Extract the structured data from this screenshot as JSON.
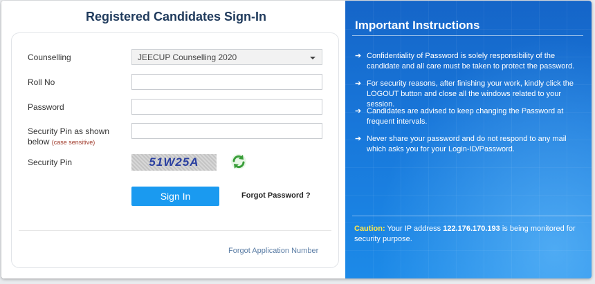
{
  "login": {
    "title": "Registered Candidates Sign-In",
    "counselling_label": "Counselling",
    "counselling_value": "JEECUP Counselling 2020",
    "rollno_label": "Roll No",
    "rollno_value": "",
    "password_label": "Password",
    "password_value": "",
    "security_pin_shown_label": "Security Pin as shown below",
    "case_sensitive": "(case sensitive)",
    "security_pin_input_value": "",
    "security_pin_label": "Security Pin",
    "captcha_text": "51W25A",
    "signin_label": "Sign In",
    "forgot_password": "Forgot Password ?",
    "forgot_application": "Forgot Application Number"
  },
  "instructions": {
    "title": "Important Instructions",
    "items": [
      "Confidentiality of Password is solely responsibility of the candidate and all care must be taken to protect the password.",
      "For security reasons, after finishing your work, kindly click the LOGOUT button and close all the windows related to your session.",
      "Candidates are advised to keep changing the Password at frequent intervals.",
      "Never share your password and do not respond to any mail which asks you for your Login-ID/Password."
    ],
    "caution_label": "Caution:",
    "caution_pre": "Your IP address",
    "ip": "122.176.170.193",
    "caution_post": "is being monitored for security purpose."
  },
  "icons": {
    "refresh": "refresh-icon",
    "dropdown": "chevron-down-icon",
    "bullet": "arrow-right-icon"
  },
  "colors": {
    "button": "#1a9af0",
    "title": "#1f3a5c",
    "caution": "#ffe84a",
    "panel_blue": "#1877da"
  }
}
